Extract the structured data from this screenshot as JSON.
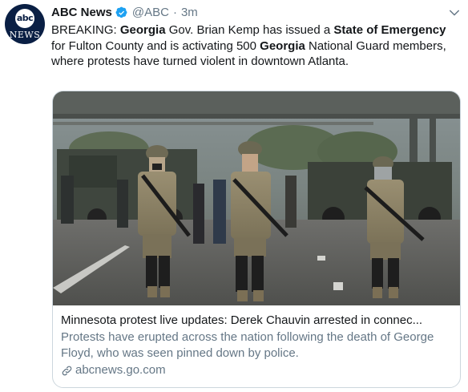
{
  "tweet": {
    "avatar": {
      "logo": "abc",
      "text": "NEWS"
    },
    "author_name": "ABC News",
    "handle": "@ABC",
    "separator": "·",
    "time": "3m",
    "text_parts": [
      {
        "text": "BREAKING: ",
        "bold": false
      },
      {
        "text": "Georgia",
        "bold": true
      },
      {
        "text": " Gov. Brian Kemp has issued a ",
        "bold": false
      },
      {
        "text": "State of Emergency",
        "bold": true
      },
      {
        "text": " for Fulton County and is activating 500 ",
        "bold": false
      },
      {
        "text": "Georgia",
        "bold": true
      },
      {
        "text": " National Guard members, where protests have turned violent in downtown Atlanta.",
        "bold": false
      }
    ]
  },
  "card": {
    "title": "Minnesota protest live updates: Derek Chauvin arrested in connec...",
    "description": "Protests have erupted across the nation following the death of George Floyd, who was seen pinned down by police.",
    "domain": "abcnews.go.com"
  },
  "colors": {
    "accent": "#1da1f2",
    "text": "#14171a",
    "muted": "#657786",
    "brand": "#0a1f44"
  },
  "icons": {
    "verified": "verified-badge-icon",
    "menu": "chevron-down-icon",
    "link": "link-icon"
  }
}
